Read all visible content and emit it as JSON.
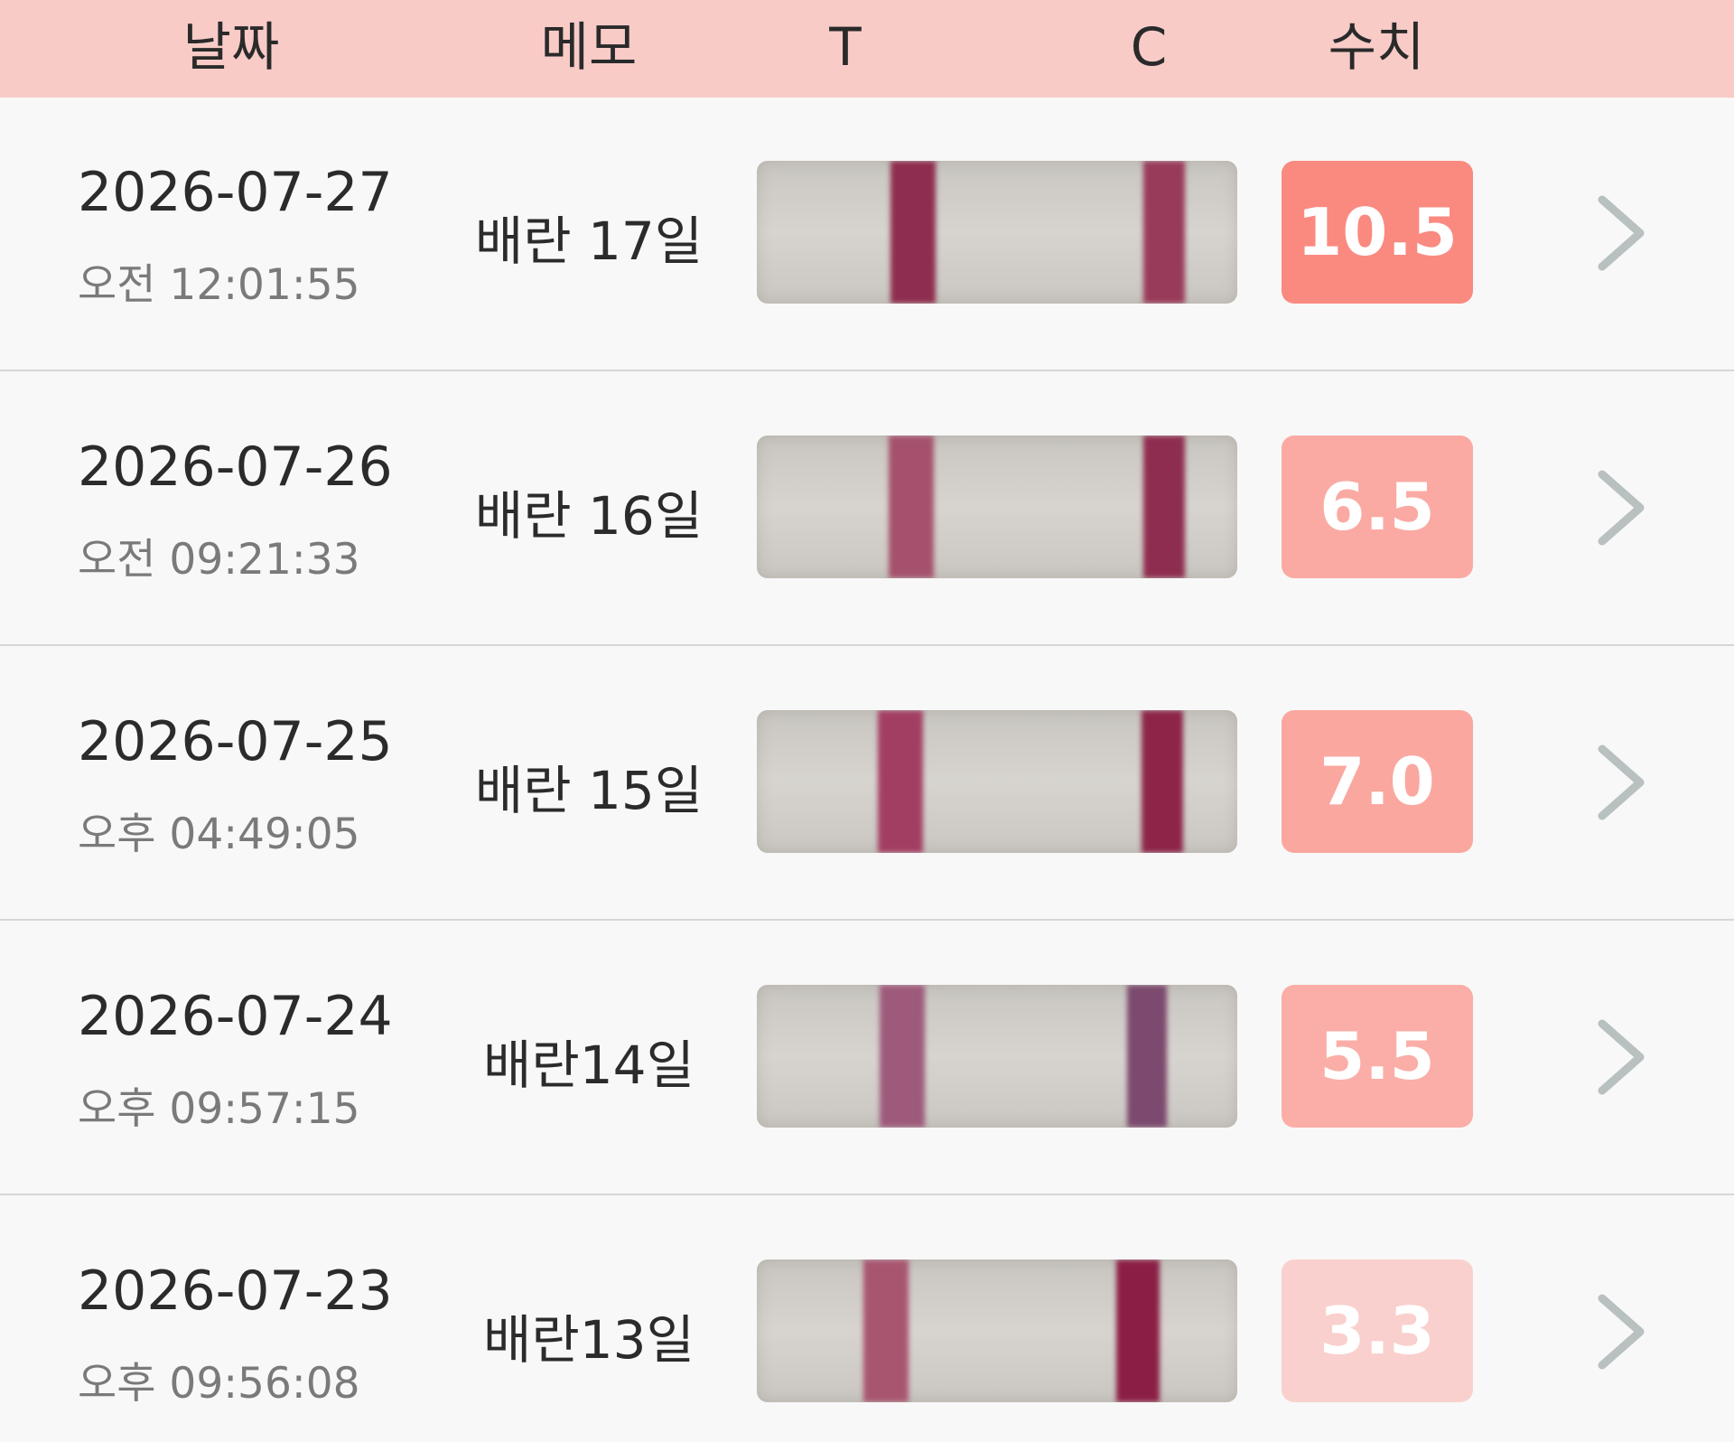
{
  "header": {
    "date_label": "날짜",
    "memo_label": "메모",
    "t_label": "T",
    "c_label": "C",
    "value_label": "수치"
  },
  "rows": [
    {
      "date": "2026-07-27",
      "time": "오전 12:01:55",
      "memo": "배란 17일",
      "value": "10.5",
      "value_color": "#fa8a80",
      "t_line_color": "#8e2d4f",
      "c_line_color": "#983a5a"
    },
    {
      "date": "2026-07-26",
      "time": "오전 09:21:33",
      "memo": "배란 16일",
      "value": "6.5",
      "value_color": "#faaaa3",
      "t_line_color": "#a5516d",
      "c_line_color": "#8e2d4f"
    },
    {
      "date": "2026-07-25",
      "time": "오후 04:49:05",
      "memo": "배란 15일",
      "value": "7.0",
      "value_color": "#faa7a0",
      "t_line_color": "#a33e63",
      "c_line_color": "#8d2549"
    },
    {
      "date": "2026-07-24",
      "time": "오후 09:57:15",
      "memo": "배란14일",
      "value": "5.5",
      "value_color": "#faaea7",
      "t_line_color": "#9e5a7b",
      "c_line_color": "#7b4a6e"
    },
    {
      "date": "2026-07-23",
      "time": "오후 09:56:08",
      "memo": "배란13일",
      "value": "3.3",
      "value_color": "#f9d0cd",
      "t_line_color": "#a85570",
      "c_line_color": "#8b1e45"
    }
  ]
}
